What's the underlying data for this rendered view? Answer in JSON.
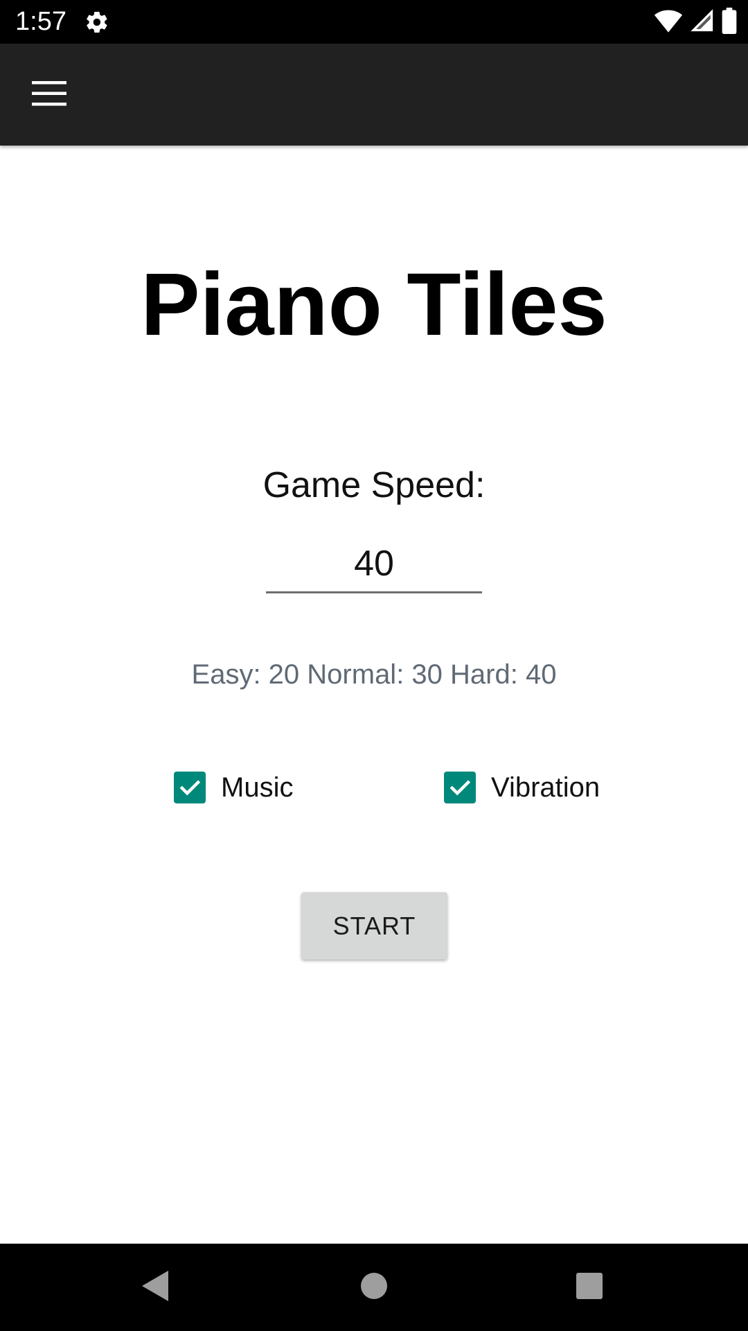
{
  "status_bar": {
    "time": "1:57",
    "icons": [
      "gear-icon",
      "wifi-icon",
      "cellular-signal-icon",
      "battery-icon"
    ]
  },
  "app_bar": {
    "menu_icon": "hamburger-menu-icon"
  },
  "main": {
    "title": "Piano Tiles",
    "speed_label": "Game Speed:",
    "speed_value": "40",
    "speed_hint": "Easy: 20 Normal: 30 Hard: 40",
    "checkboxes": [
      {
        "label": "Music",
        "checked": true
      },
      {
        "label": "Vibration",
        "checked": true
      }
    ],
    "start_label": "START"
  },
  "nav_bar": {
    "icons": [
      "back-icon",
      "home-icon",
      "recents-icon"
    ]
  },
  "colors": {
    "status_bar": "#000000",
    "app_bar": "#212121",
    "checkbox_accent": "#00897b",
    "button_bg": "#d6d7d7",
    "hint_text": "#5f6a75"
  }
}
